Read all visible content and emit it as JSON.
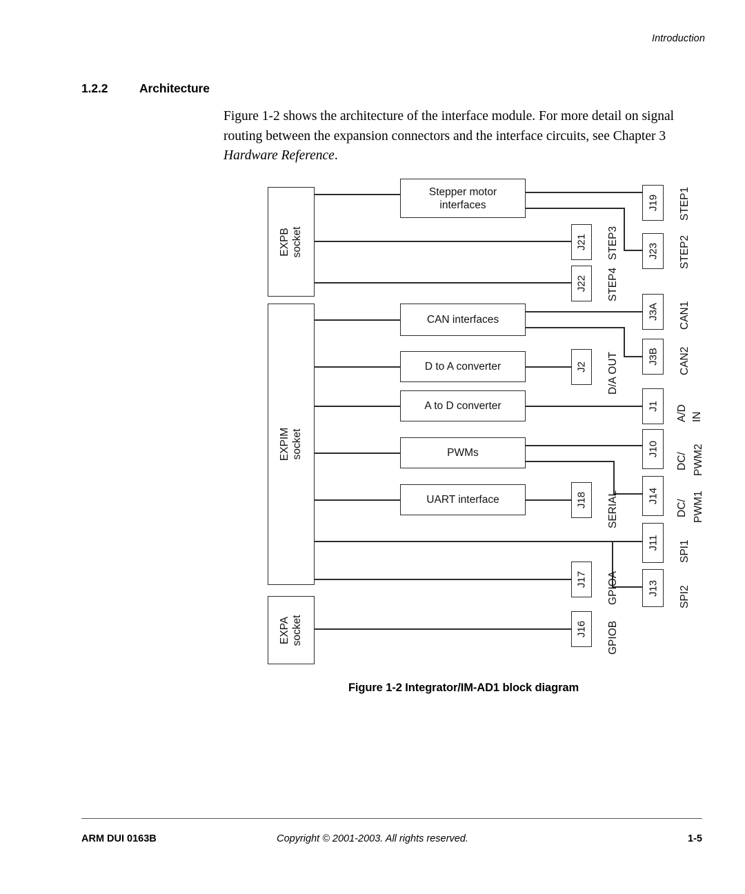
{
  "page": {
    "running_header": "Introduction",
    "footer_left": "ARM DUI 0163B",
    "footer_center": "Copyright © 2001-2003. All rights reserved.",
    "footer_right": "1-5"
  },
  "section": {
    "number": "1.2.2",
    "title": "Architecture",
    "paragraph": "Figure 1-2 shows the architecture of the interface module. For more detail on signal routing between the expansion connectors and the interface circuits, see Chapter 3 ",
    "paragraph_italic": "Hardware Reference",
    "paragraph_tail": "."
  },
  "figure": {
    "caption": "Figure 1-2 Integrator/IM-AD1 block diagram",
    "sockets": [
      {
        "id": "expb",
        "line1": "EXPB",
        "line2": "socket"
      },
      {
        "id": "expim",
        "line1": "EXPIM",
        "line2": "socket"
      },
      {
        "id": "expa",
        "line1": "EXPA",
        "line2": "socket"
      }
    ],
    "blocks": [
      {
        "id": "stepper",
        "label": "Stepper motor\ninterfaces",
        "line1": "Stepper motor",
        "line2": "interfaces"
      },
      {
        "id": "can",
        "label": "CAN interfaces",
        "line1": "CAN interfaces",
        "line2": ""
      },
      {
        "id": "dac",
        "label": "D to A converter",
        "line1": "D to A converter",
        "line2": ""
      },
      {
        "id": "adc",
        "label": "A to D converter",
        "line1": "A to D converter",
        "line2": ""
      },
      {
        "id": "pwm",
        "label": "PWMs",
        "line1": "PWMs",
        "line2": ""
      },
      {
        "id": "uart",
        "label": "UART interface",
        "line1": "UART interface",
        "line2": ""
      }
    ],
    "connectors": [
      {
        "id": "j19",
        "ref": "J19",
        "signal": "STEP1",
        "signal_l2": ""
      },
      {
        "id": "j21",
        "ref": "J21",
        "signal": "STEP3",
        "signal_l2": ""
      },
      {
        "id": "j23",
        "ref": "J23",
        "signal": "STEP2",
        "signal_l2": ""
      },
      {
        "id": "j22",
        "ref": "J22",
        "signal": "STEP4",
        "signal_l2": ""
      },
      {
        "id": "j3a",
        "ref": "J3A",
        "signal": "CAN1",
        "signal_l2": ""
      },
      {
        "id": "j3b",
        "ref": "J3B",
        "signal": "CAN2",
        "signal_l2": ""
      },
      {
        "id": "j2",
        "ref": "J2",
        "signal": "D/A OUT",
        "signal_l2": ""
      },
      {
        "id": "j1",
        "ref": "J1",
        "signal": "A/D",
        "signal_l2": "IN"
      },
      {
        "id": "j10",
        "ref": "J10",
        "signal": "DC/",
        "signal_l2": "PWM2"
      },
      {
        "id": "j18",
        "ref": "J18",
        "signal": "SERIAL",
        "signal_l2": ""
      },
      {
        "id": "j14",
        "ref": "J14",
        "signal": "DC/",
        "signal_l2": "PWM1"
      },
      {
        "id": "j11",
        "ref": "J11",
        "signal": "SPI1",
        "signal_l2": ""
      },
      {
        "id": "j17",
        "ref": "J17",
        "signal": "GPIOA",
        "signal_l2": ""
      },
      {
        "id": "j13",
        "ref": "J13",
        "signal": "SPI2",
        "signal_l2": ""
      },
      {
        "id": "j16",
        "ref": "J16",
        "signal": "GPIOB",
        "signal_l2": ""
      }
    ],
    "colors": {
      "line": "#2b2b2b",
      "text": "#111111",
      "background": "#ffffff"
    }
  }
}
